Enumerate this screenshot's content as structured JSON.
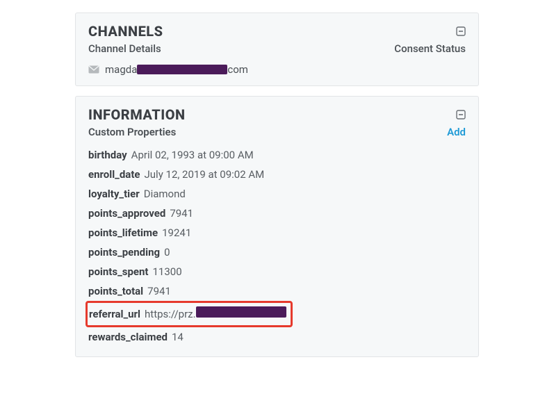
{
  "channels": {
    "title": "CHANNELS",
    "subhead_left": "Channel Details",
    "subhead_right": "Consent Status",
    "email_prefix": "magda",
    "email_suffix": "com"
  },
  "information": {
    "title": "INFORMATION",
    "subhead": "Custom Properties",
    "add_label": "Add",
    "props": {
      "birthday_key": "birthday",
      "birthday_val": "April 02, 1993 at 09:00 AM",
      "enroll_date_key": "enroll_date",
      "enroll_date_val": "July 12, 2019 at 09:02 AM",
      "loyalty_tier_key": "loyalty_tier",
      "loyalty_tier_val": "Diamond",
      "points_approved_key": "points_approved",
      "points_approved_val": "7941",
      "points_lifetime_key": "points_lifetime",
      "points_lifetime_val": "19241",
      "points_pending_key": "points_pending",
      "points_pending_val": "0",
      "points_spent_key": "points_spent",
      "points_spent_val": "11300",
      "points_total_key": "points_total",
      "points_total_val": "7941",
      "referral_url_key": "referral_url",
      "referral_url_val_prefix": "https://prz.",
      "rewards_claimed_key": "rewards_claimed",
      "rewards_claimed_val": "14"
    }
  }
}
